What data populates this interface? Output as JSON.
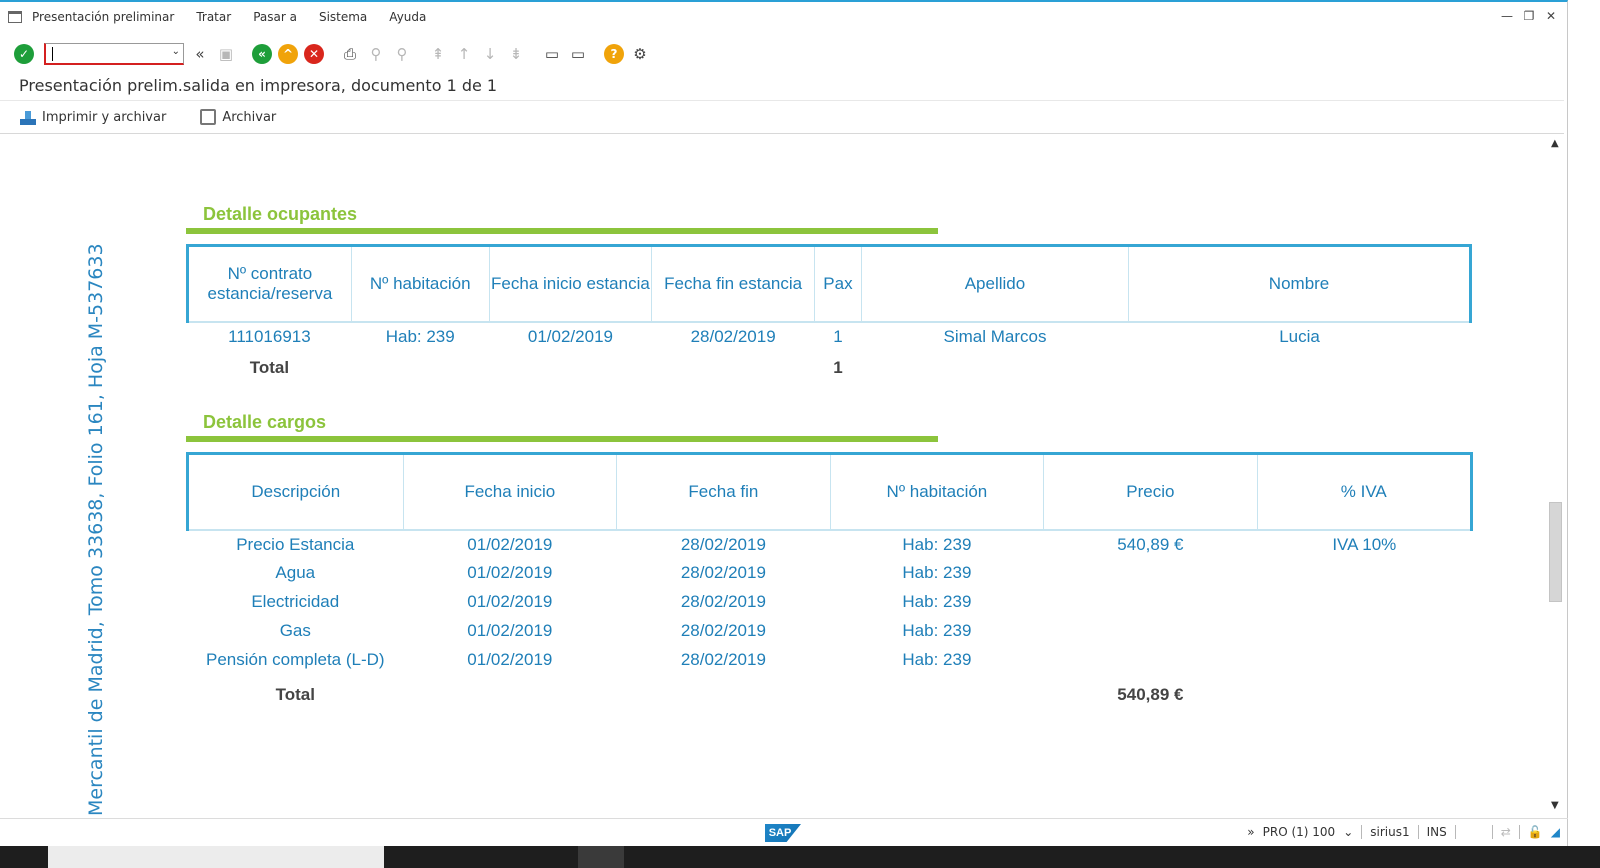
{
  "menu": {
    "items": [
      "Presentación preliminar",
      "Tratar",
      "Pasar a",
      "Sistema",
      "Ayuda"
    ]
  },
  "toolbar": {
    "command_field_value": ""
  },
  "title": "Presentación prelim.salida en impresora, documento 1 de 1",
  "app_toolbar": {
    "print_archive": "Imprimir y archivar",
    "archive": "Archivar"
  },
  "document": {
    "side_text": "Mercantil de Madrid, Tomo 33638, Folio 161, Hoja M-537633",
    "occupants": {
      "title": "Detalle ocupantes",
      "headers": [
        "Nº contrato estancia/reserva",
        "Nº habitación",
        "Fecha inicio estancia",
        "Fecha fin estancia",
        "Pax",
        "Apellido",
        "Nombre"
      ],
      "rows": [
        [
          "111016913",
          "Hab: 239",
          "01/02/2019",
          "28/02/2019",
          "1",
          "Simal Marcos",
          "Lucia"
        ]
      ],
      "total_label": "Total",
      "total_pax": "1"
    },
    "charges": {
      "title": "Detalle cargos",
      "headers": [
        "Descripción",
        "Fecha inicio",
        "Fecha fin",
        "Nº habitación",
        "Precio",
        "% IVA"
      ],
      "rows": [
        [
          "Precio Estancia",
          "01/02/2019",
          "28/02/2019",
          "Hab: 239",
          "540,89 €",
          "IVA 10%"
        ],
        [
          "Agua",
          "01/02/2019",
          "28/02/2019",
          "Hab: 239",
          "",
          ""
        ],
        [
          "Electricidad",
          "01/02/2019",
          "28/02/2019",
          "Hab: 239",
          "",
          ""
        ],
        [
          "Gas",
          "01/02/2019",
          "28/02/2019",
          "Hab: 239",
          "",
          ""
        ],
        [
          "Pensión completa (L-D)",
          "01/02/2019",
          "28/02/2019",
          "Hab: 239",
          "",
          ""
        ]
      ],
      "total_label": "Total",
      "total_price": "540,89 €"
    }
  },
  "status": {
    "system": "PRO (1) 100",
    "server": "sirius1",
    "mode": "INS"
  },
  "colors": {
    "accent_blue": "#36a6d4",
    "text_blue": "#1f7fb8",
    "section_green": "#8cc43c"
  }
}
